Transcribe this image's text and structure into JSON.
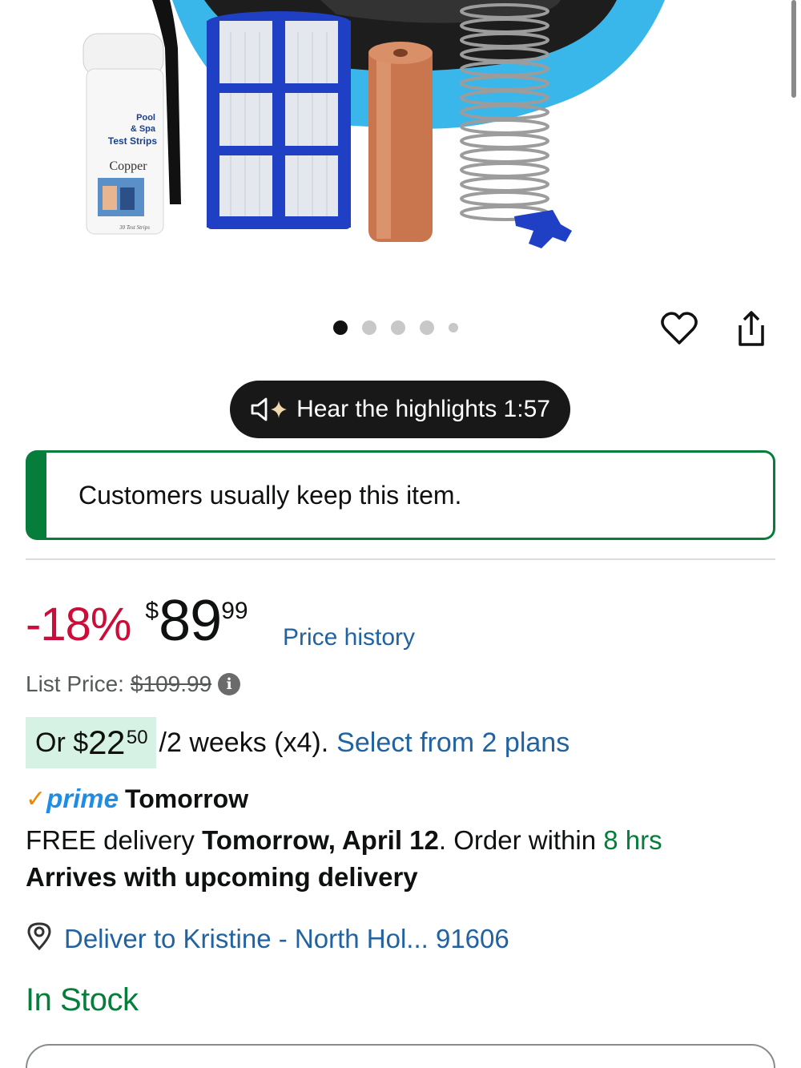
{
  "gallery": {
    "dots": 5,
    "active_index": 0,
    "bottle_label": [
      "Pool",
      "& Spa",
      "Test Strips"
    ],
    "bottle_sublabel": "Copper",
    "bottle_count": "30 Test Strips"
  },
  "actions": {
    "wishlist_icon": "heart-icon",
    "share_icon": "share-icon"
  },
  "audio": {
    "label": "Hear the highlights 1:57"
  },
  "notice": {
    "text": "Customers usually keep this item."
  },
  "price": {
    "discount": "-18%",
    "currency": "$",
    "whole": "89",
    "fraction": "99",
    "history_link": "Price history",
    "list_label": "List Price:",
    "list_value": "$109.99"
  },
  "installments": {
    "prefix": "Or $",
    "whole": "22",
    "fraction": "50",
    "suffix": "/2 weeks (x4).",
    "link": "Select from 2 plans"
  },
  "prime": {
    "check": "✓",
    "word": "prime",
    "when": "Tomorrow"
  },
  "delivery": {
    "free_text": "FREE delivery",
    "date": "Tomorrow, April 12",
    "order_within": ". Order within",
    "time_left": "8 hrs",
    "arrives": "Arrives with upcoming delivery"
  },
  "location": {
    "text": "Deliver to Kristine - North Hol... 91606"
  },
  "stock": {
    "status": "In Stock"
  },
  "colors": {
    "accent_link": "#2162a1",
    "deal_red": "#cc0c39",
    "green": "#067d3a",
    "prime_blue": "#1f8ce6"
  }
}
